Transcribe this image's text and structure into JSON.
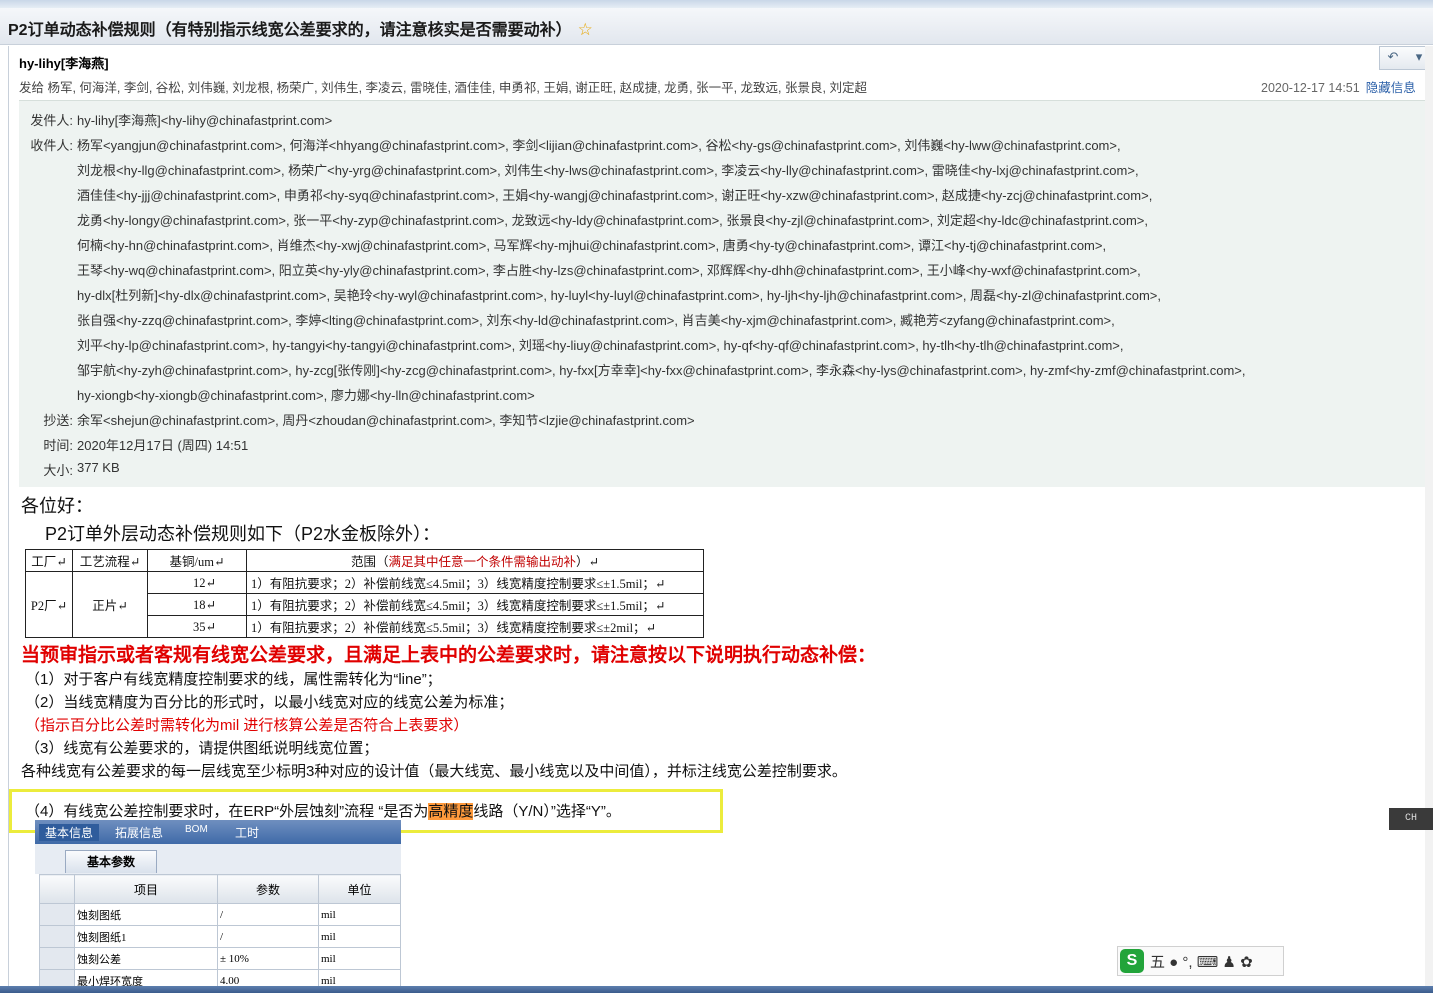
{
  "title": "P2订单动态补偿规则（有特别指示线宽公差要求的，请注意核实是否需要动补）",
  "star": "☆",
  "sender_display": "hy-lihy[李海燕]",
  "to_summary": "发给 杨军, 何海洋, 李剑, 谷松, 刘伟巍, 刘龙根, 杨荣广, 刘伟生, 李凌云, 雷晓佳, 酒佳佳, 申勇祁, 王娟, 谢正旺, 赵成捷, 龙勇, 张一平, 龙致远, 张景良, 刘定超",
  "date_short": "2020-12-17 14:51",
  "hide_info": "隐藏信息",
  "reply_icons": {
    "reply": "↶",
    "more": "▾"
  },
  "header": {
    "from_label": "发件人:",
    "from": "hy-lihy[李海燕]<hy-lihy@chinafastprint.com>",
    "to_label": "收件人:",
    "to_lines": [
      "杨军<yangjun@chinafastprint.com>,  何海洋<hhyang@chinafastprint.com>,  李剑<lijian@chinafastprint.com>,  谷松<hy-gs@chinafastprint.com>,  刘伟巍<hy-lww@chinafastprint.com>,",
      "刘龙根<hy-llg@chinafastprint.com>,  杨荣广<hy-yrg@chinafastprint.com>,  刘伟生<hy-lws@chinafastprint.com>,  李凌云<hy-lly@chinafastprint.com>,  雷晓佳<hy-lxj@chinafastprint.com>,",
      "酒佳佳<hy-jjj@chinafastprint.com>,  申勇祁<hy-syq@chinafastprint.com>,  王娟<hy-wangj@chinafastprint.com>,  谢正旺<hy-xzw@chinafastprint.com>,  赵成捷<hy-zcj@chinafastprint.com>,",
      "龙勇<hy-longy@chinafastprint.com>,  张一平<hy-zyp@chinafastprint.com>,  龙致远<hy-ldy@chinafastprint.com>,  张景良<hy-zjl@chinafastprint.com>,  刘定超<hy-ldc@chinafastprint.com>,",
      "何楠<hy-hn@chinafastprint.com>,  肖维杰<hy-xwj@chinafastprint.com>,  马军辉<hy-mjhui@chinafastprint.com>,  唐勇<hy-ty@chinafastprint.com>,  谭江<hy-tj@chinafastprint.com>,",
      "王琴<hy-wq@chinafastprint.com>,  阳立英<hy-yly@chinafastprint.com>,  李占胜<hy-lzs@chinafastprint.com>,  邓辉辉<hy-dhh@chinafastprint.com>,  王小峰<hy-wxf@chinafastprint.com>,",
      "hy-dlx[杜列新]<hy-dlx@chinafastprint.com>,  吴艳玲<hy-wyl@chinafastprint.com>,  hy-luyl<hy-luyl@chinafastprint.com>,  hy-ljh<hy-ljh@chinafastprint.com>,  周磊<hy-zl@chinafastprint.com>,",
      "张自强<hy-zzq@chinafastprint.com>,  李婷<lting@chinafastprint.com>,  刘东<hy-ld@chinafastprint.com>,  肖吉美<hy-xjm@chinafastprint.com>,  臧艳芳<zyfang@chinafastprint.com>,",
      "刘平<hy-lp@chinafastprint.com>,  hy-tangyi<hy-tangyi@chinafastprint.com>,  刘瑶<hy-liuy@chinafastprint.com>,  hy-qf<hy-qf@chinafastprint.com>,  hy-tlh<hy-tlh@chinafastprint.com>,",
      "邹宇航<hy-zyh@chinafastprint.com>,  hy-zcg[张传刚]<hy-zcg@chinafastprint.com>,  hy-fxx[方幸幸]<hy-fxx@chinafastprint.com>,  李永森<hy-lys@chinafastprint.com>,  hy-zmf<hy-zmf@chinafastprint.com>,",
      "hy-xiongb<hy-xiongb@chinafastprint.com>,  廖力娜<hy-lln@chinafastprint.com>"
    ],
    "cc_label": "抄送:",
    "cc": "余军<shejun@chinafastprint.com>,  周丹<zhoudan@chinafastprint.com>,  李知节<lzjie@chinafastprint.com>",
    "time_label": "时间:",
    "time": "2020年12月17日 (周四) 14:51",
    "size_label": "大小:",
    "size": "377 KB"
  },
  "body": {
    "greeting": "各位好：",
    "intro": "P2订单外层动态补偿规则如下（P2水金板除外）：",
    "table": {
      "headers": [
        "工厂↵",
        "工艺流程↵",
        "基铜/um↵",
        "范围（",
        "满足其中任意一个条件需输出动补",
        "）↵"
      ],
      "factory": "P2厂↵",
      "process": "正片↵",
      "rows": [
        {
          "cu": "12↵",
          "range": "1）有阻抗要求；2）补偿前线宽≤4.5mil；3）线宽精度控制要求≤±1.5mil；↵"
        },
        {
          "cu": "18↵",
          "range": "1）有阻抗要求；2）补偿前线宽≤4.5mil；3）线宽精度控制要求≤±1.5mil；↵"
        },
        {
          "cu": "35↵",
          "range": "1）有阻抗要求；2）补偿前线宽≤5.5mil；3）线宽精度控制要求≤±2mil；↵"
        }
      ]
    },
    "warning": "当预审指示或者客规有线宽公差要求，且满足上表中的公差要求时，请注意按以下说明执行动态补偿：",
    "p1": "（1）对于客户有线宽精度控制要求的线，属性需转化为“line”；",
    "p2": "（2）当线宽精度为百分比的形式时，以最小线宽对应的线宽公差为标准；",
    "p2_note": "（指示百分比公差时需转化为mil 进行核算公差是否符合上表要求）",
    "p3": "（3）线宽有公差要求的，请提供图纸说明线宽位置；",
    "p3b": "各种线宽有公差要求的每一层线宽至少标明3种对应的设计值（最大线宽、最小线宽以及中间值），并标注线宽公差控制要求。",
    "p4_a": "（4）有线宽公差控制要求时，在ERP“外层蚀刻”流程 “是否为",
    "p4_hl": "高精度",
    "p4_b": "线路（Y/N）”选择“Y”。"
  },
  "erp": {
    "tabs": [
      "基本信息",
      "拓展信息",
      "BOM",
      "工时"
    ],
    "subtab": "基本参数",
    "columns": [
      "项目",
      "参数",
      "单位"
    ],
    "rows": [
      {
        "item": "蚀刻图纸",
        "value": "/",
        "unit": "mil"
      },
      {
        "item": "蚀刻图纸1",
        "value": "/",
        "unit": "mil"
      },
      {
        "item": "蚀刻公差",
        "value": "± 10%",
        "unit": "mil"
      },
      {
        "item": "最小焊环宽度",
        "value": "4.00",
        "unit": "mil"
      }
    ]
  },
  "ime": {
    "logo": "S",
    "items": "五 ● °, ⌨ ♟ ✿"
  },
  "ch_tag": "CH"
}
